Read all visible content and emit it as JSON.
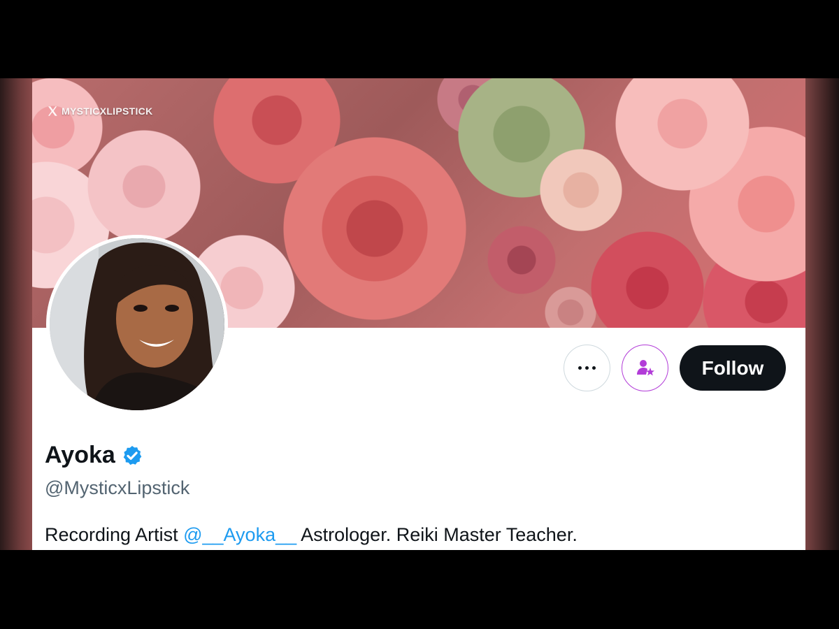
{
  "banner": {
    "watermark_text": "MYSTICXLIPSTICK",
    "watermark_icon": "x-logo-icon"
  },
  "profile": {
    "display_name": "Ayoka",
    "verified": true,
    "verified_color": "#1d9bf0",
    "handle": "@MysticxLipstick",
    "bio": {
      "prefix": "Recording Artist ",
      "mention": "@__Ayoka__",
      "suffix": " Astrologer. Reiki Master Teacher."
    }
  },
  "actions": {
    "more_icon": "more-dots-icon",
    "subscribe_icon": "subscribe-user-star-icon",
    "subscribe_color": "#b23cd8",
    "follow_label": "Follow"
  },
  "colors": {
    "text_primary": "#0f1419",
    "text_secondary": "#536471",
    "link": "#1d9bf0",
    "button_dark": "#0f1419"
  }
}
